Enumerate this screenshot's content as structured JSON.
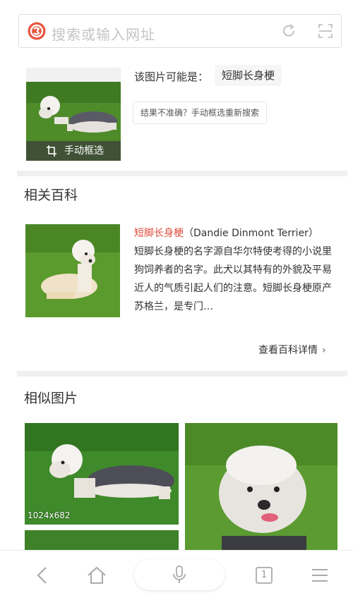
{
  "search": {
    "placeholder": "搜索或输入网址",
    "logo_icon": "sogou-logo-icon",
    "refresh_icon": "refresh-icon",
    "scan_icon": "scan-icon"
  },
  "recognition": {
    "maybe_label": "该图片可能是：",
    "result": "短脚长身梗",
    "manual_label": "结果不准确？手动框选重新搜索",
    "thumb_caption": "手动框选"
  },
  "encyclopedia": {
    "title": "相关百科",
    "term": "短脚长身梗",
    "term_en": "（Dandie Dinmont Terrier）",
    "description": "短脚长身梗的名字源自华尔特使考得的小说里狗饲养者的名字。此犬以其特有的外貌及平易近人的气质引起人们的注意。短脚长身梗原产苏格兰，是专门…",
    "more_label": "查看百科详情",
    "more_chevron": "›"
  },
  "similar": {
    "title": "相似图片",
    "first_size": "1024x682"
  },
  "toolbar": {
    "items": [
      "back-icon",
      "home-icon",
      "microphone-icon",
      "tabs-icon",
      "menu-icon"
    ],
    "tab_count": "1"
  },
  "colors": {
    "accent": "#e24c3d",
    "grass": "#5a9a2f",
    "divider": "#f0f0f0"
  }
}
